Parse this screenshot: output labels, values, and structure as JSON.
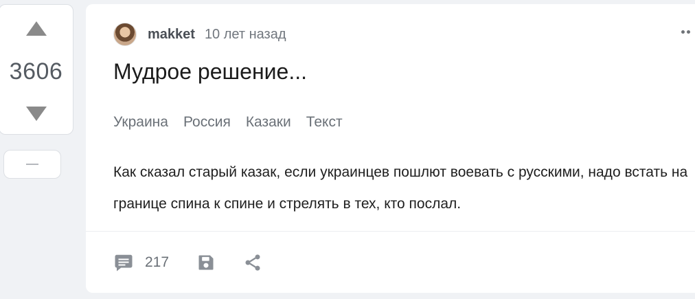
{
  "rating": {
    "value": "3606",
    "up_icon": "triangle-up-icon",
    "down_icon": "triangle-down-icon",
    "minus_icon": "minus-icon"
  },
  "post": {
    "author": "makket",
    "time": "10 лет назад",
    "title": "Мудрое решение...",
    "tags": [
      "Украина",
      "Россия",
      "Казаки",
      "Текст"
    ],
    "body": "Как сказал старый казак, если украинцев пошлют воевать с русскими, надо встать на границе спина к спине и стрелять в тех, кто послал.",
    "comments_count": "217"
  },
  "colors": {
    "background": "#f0f2f5",
    "card": "#ffffff",
    "icon": "#8a8f96",
    "text": "#1e1e1e",
    "muted": "#6a7077"
  }
}
